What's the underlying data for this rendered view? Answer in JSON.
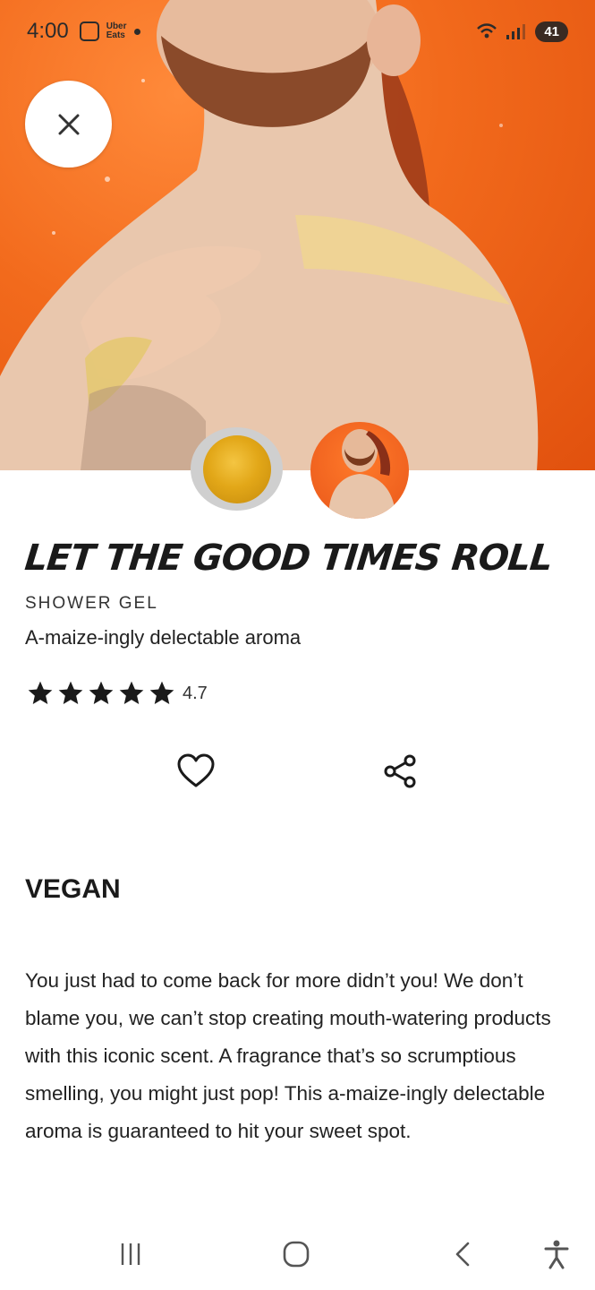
{
  "status_bar": {
    "time": "4:00",
    "uber_eats_label": "Uber\nEats",
    "battery": "41"
  },
  "product": {
    "title": "LET THE GOOD TIMES ROLL",
    "type": "SHOWER GEL",
    "tagline": "A-maize-ingly delectable aroma",
    "rating": "4.7",
    "stars_filled": 5,
    "badge": "VEGAN",
    "description": "You just had to come back for more didn’t you! We don’t blame you, we can’t stop creating mouth-watering products with this iconic scent. A fragrance that’s so scrumptious smelling, you might just pop! This a-maize-ingly delectable aroma is guaranteed to hit your sweet spot."
  },
  "icons": {
    "close": "close-icon",
    "like": "heart-icon",
    "share": "share-icon",
    "nav_recents": "recents-icon",
    "nav_home": "home-icon",
    "nav_back": "back-icon",
    "nav_accessibility": "accessibility-icon"
  },
  "colors": {
    "hero_orange": "#f26a1c",
    "star": "#1a1a1a"
  }
}
